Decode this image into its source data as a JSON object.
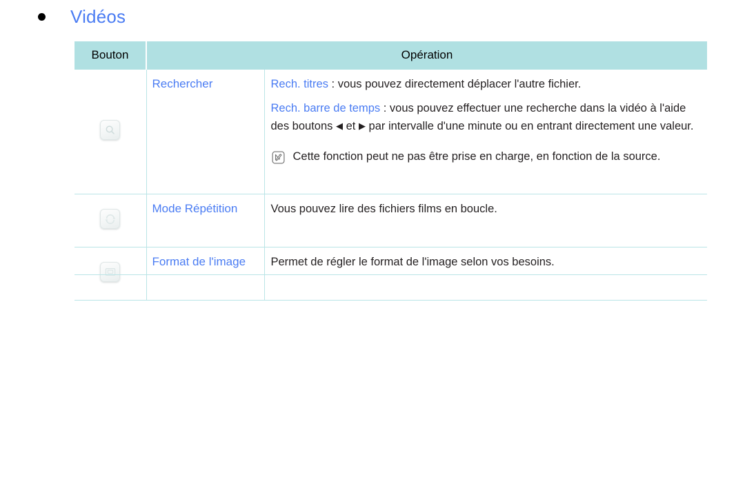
{
  "page": {
    "title": "Vidéos",
    "bullet": "filled-disc",
    "accent_color": "#4a7cf3",
    "header_bg_color": "#b0e0e2",
    "border_color": "#b9e4e6",
    "text_color": "#231f20"
  },
  "table": {
    "columns": [
      {
        "key": "button",
        "label": "Bouton"
      },
      {
        "key": "operation",
        "label": "Opération"
      }
    ],
    "rows": [
      {
        "icon_name": "search-button-icon",
        "name": "Rechercher",
        "paragraphs": [
          {
            "accent": "Rech. titres",
            "rest": " : vous pouvez directement déplacer l'autre fichier."
          },
          {
            "accent": "Rech. barre de temps",
            "rest_before_arrows": " : vous pouvez effectuer une recherche dans la vidéo à l'aide des boutons ",
            "arrow_left": "◀",
            "between_arrows": " et ",
            "arrow_right": "▶",
            "rest_after_arrows": " par intervalle d'une minute ou en entrant directement une valeur."
          }
        ],
        "note": {
          "icon_name": "samsung-note-icon",
          "text": "Cette fonction peut ne pas être prise en charge, en fonction de la source."
        }
      },
      {
        "icon_name": "repeat-mode-button-icon",
        "name": "Mode Répétition",
        "description": "Vous pouvez lire des fichiers films en boucle."
      },
      {
        "icon_name": "picture-format-button-icon",
        "name": "Format de l'image",
        "description": "Permet de régler le format de l'image selon vos besoins."
      }
    ]
  }
}
